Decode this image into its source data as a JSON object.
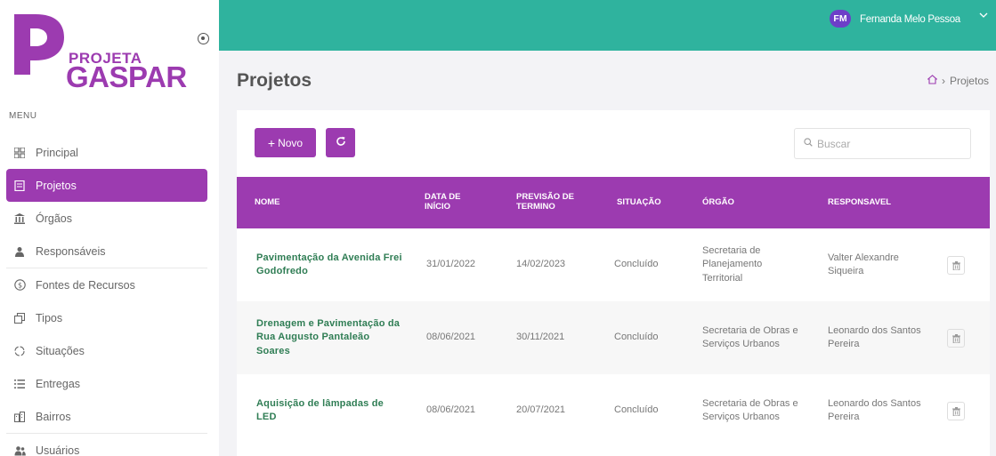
{
  "app": {
    "logo_top": "PROJETA",
    "logo_bottom": "GASPAR"
  },
  "colors": {
    "brand": "#9c3bb0",
    "topbar": "#2fb39e",
    "link_green": "#2f7d54"
  },
  "user": {
    "initials": "FM",
    "name": "Fernanda Melo Pessoa"
  },
  "sidebar": {
    "menu_title": "MENU",
    "items": [
      {
        "label": "Principal",
        "icon": "grid-icon"
      },
      {
        "label": "Projetos",
        "icon": "document-icon",
        "active": true
      },
      {
        "label": "Órgãos",
        "icon": "building-icon"
      },
      {
        "label": "Responsáveis",
        "icon": "person-icon"
      },
      {
        "label": "Fontes de Recursos",
        "icon": "dollar-circle-icon"
      },
      {
        "label": "Tipos",
        "icon": "copy-icon"
      },
      {
        "label": "Situações",
        "icon": "circle-dashed-icon"
      },
      {
        "label": "Entregas",
        "icon": "list-icon"
      },
      {
        "label": "Bairros",
        "icon": "city-icon"
      },
      {
        "label": "Usuários",
        "icon": "users-icon"
      }
    ]
  },
  "page": {
    "title": "Projetos",
    "breadcrumb": "Projetos"
  },
  "toolbar": {
    "new_label": "Novo",
    "search_placeholder": "Buscar"
  },
  "table": {
    "headers": {
      "nome": "NOME",
      "data_inicio": "DATA DE INÍCIO",
      "previsao": "PREVISÃO DE TERMINO",
      "situacao": "SITUAÇÃO",
      "orgao": "ÓRGÃO",
      "responsavel": "RESPONSAVEL"
    },
    "rows": [
      {
        "nome": "Pavimentação da Avenida Frei Godofredo",
        "data_inicio": "31/01/2022",
        "previsao": "14/02/2023",
        "situacao": "Concluído",
        "orgao": "Secretaria de Planejamento Territorial",
        "responsavel": "Valter Alexandre Siqueira"
      },
      {
        "nome": "Drenagem e Pavimentação da Rua Augusto Pantaleão Soares",
        "data_inicio": "08/06/2021",
        "previsao": "30/11/2021",
        "situacao": "Concluído",
        "orgao": "Secretaria de Obras e Serviços Urbanos",
        "responsavel": "Leonardo dos Santos Pereira"
      },
      {
        "nome": "Aquisição de lâmpadas de LED",
        "data_inicio": "08/06/2021",
        "previsao": "20/07/2021",
        "situacao": "Concluído",
        "orgao": "Secretaria de Obras e Serviços Urbanos",
        "responsavel": "Leonardo dos Santos Pereira"
      }
    ]
  }
}
